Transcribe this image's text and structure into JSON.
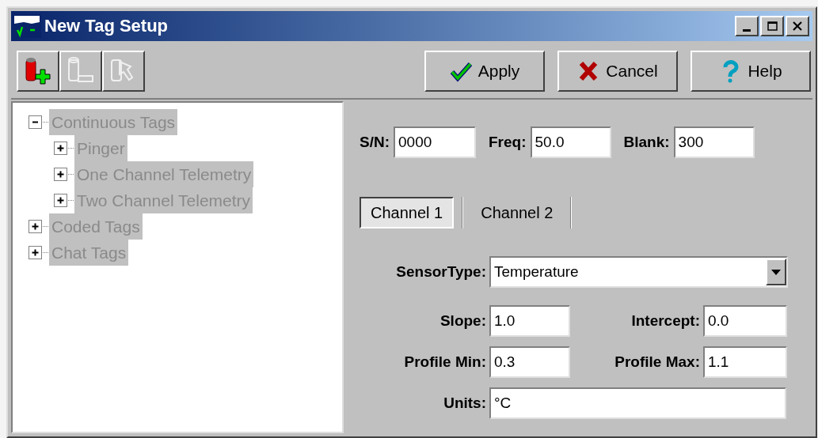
{
  "window": {
    "title": "New Tag Setup",
    "controls": [
      {
        "kind": "minimize"
      },
      {
        "kind": "maximize"
      },
      {
        "kind": "close"
      }
    ]
  },
  "toolbar": [
    {
      "kind": "add",
      "disabled": false
    },
    {
      "kind": "remove",
      "disabled": true
    },
    {
      "kind": "edit",
      "disabled": true
    }
  ],
  "buttons": [
    {
      "kind": "apply",
      "label": "Apply"
    },
    {
      "kind": "cancel",
      "label": "Cancel"
    },
    {
      "kind": "help",
      "label": "Help"
    }
  ],
  "tree": [
    {
      "label": "Continuous Tags",
      "expanded": true,
      "disabled": true,
      "children": [
        {
          "label": "Pinger",
          "expanded": false,
          "disabled": true
        },
        {
          "label": "One Channel Telemetry",
          "expanded": false,
          "disabled": true
        },
        {
          "label": "Two Channel Telemetry",
          "expanded": false,
          "disabled": true
        }
      ]
    },
    {
      "label": "Coded Tags",
      "expanded": false,
      "disabled": true
    },
    {
      "label": "Chat Tags",
      "expanded": false,
      "disabled": true
    }
  ],
  "header_fields": [
    {
      "label": "S/N:",
      "value": "0000"
    },
    {
      "label": "Freq:",
      "value": "50.0"
    },
    {
      "label": "Blank:",
      "value": "300"
    }
  ],
  "tabs": [
    {
      "label": "Channel 1",
      "selected": true
    },
    {
      "label": "Channel 2",
      "selected": false
    }
  ],
  "sensor_type": {
    "label": "SensorType:",
    "value": "Temperature"
  },
  "channel_fields": [
    {
      "label": "Slope:",
      "value": "1.0"
    },
    {
      "label": "Intercept:",
      "value": "0.0"
    },
    {
      "label": "Profile Min:",
      "value": "0.3"
    },
    {
      "label": "Profile Max:",
      "value": "1.1"
    }
  ],
  "units": {
    "label": "Units:",
    "value": "°C"
  }
}
